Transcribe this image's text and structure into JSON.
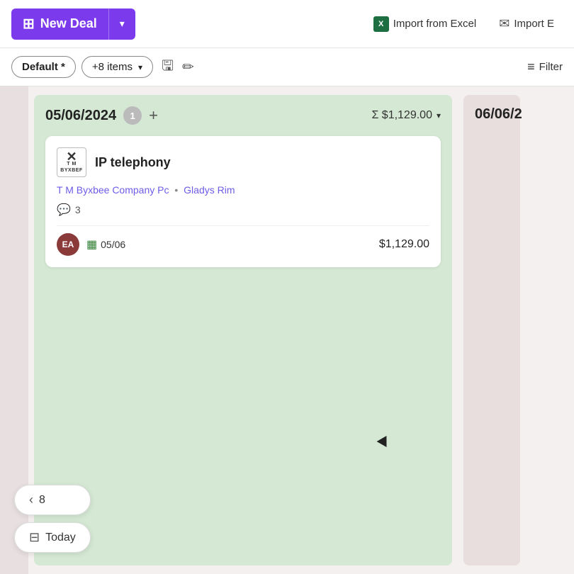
{
  "toolbar": {
    "new_deal_label": "New Deal",
    "import_excel_label": "Import from Excel",
    "import_email_label": "Import E",
    "new_deal_icon": "🖥",
    "excel_letter": "X"
  },
  "toolbar2": {
    "default_label": "Default *",
    "items_label": "+8 items",
    "filter_label": "Filter",
    "save_icon": "💾",
    "edit_icon": "✏️",
    "filter_icon": "≡"
  },
  "columns": [
    {
      "date": "05/06/2024",
      "count": "1",
      "sum": "Σ $1,129.00",
      "deals": [
        {
          "company_logo_x": "✕",
          "company_logo_text": "T M BYXBEF",
          "title": "IP telephony",
          "company1": "T M Byxbee Company Pc",
          "company2": "Gladys Rim",
          "notes_count": "3",
          "avatar_initials": "EA",
          "deal_date": "05/06",
          "amount": "$1,129.00"
        }
      ]
    },
    {
      "date": "06/06/2",
      "count": "",
      "sum": "",
      "deals": []
    }
  ],
  "floating_buttons": [
    {
      "icon": "‹",
      "label": "8"
    },
    {
      "icon": "⊞",
      "label": "Today"
    }
  ]
}
